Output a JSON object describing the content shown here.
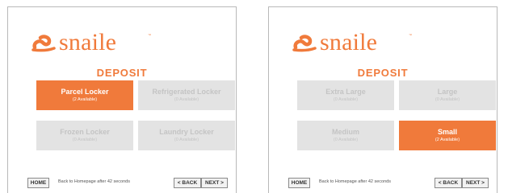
{
  "brand": {
    "name": "snaile",
    "tm": "™",
    "color": "#f07a3b"
  },
  "screens": [
    {
      "title": "DEPOSIT",
      "tiles": [
        {
          "label": "Parcel Locker",
          "sub": "(2 Available)",
          "selected": true
        },
        {
          "label": "Refrigerated Locker",
          "sub": "(0 Available)",
          "selected": false
        },
        {
          "label": "Frozen Locker",
          "sub": "(0 Available)",
          "selected": false
        },
        {
          "label": "Laundry Locker",
          "sub": "(0 Available)",
          "selected": false
        }
      ],
      "footer": {
        "home": "HOME",
        "note": "Back to Homepage after 42 seconds",
        "back": "< BACK",
        "next": "NEXT >"
      }
    },
    {
      "title": "DEPOSIT",
      "tiles": [
        {
          "label": "Extra Large",
          "sub": "(0 Available)",
          "selected": false
        },
        {
          "label": "Large",
          "sub": "(0 Available)",
          "selected": false
        },
        {
          "label": "Medium",
          "sub": "(0 Available)",
          "selected": false
        },
        {
          "label": "Small",
          "sub": "(2 Available)",
          "selected": true
        }
      ],
      "footer": {
        "home": "HOME",
        "note": "Back to Homepage after 42 seconds",
        "back": "< BACK",
        "next": "NEXT >"
      }
    }
  ]
}
